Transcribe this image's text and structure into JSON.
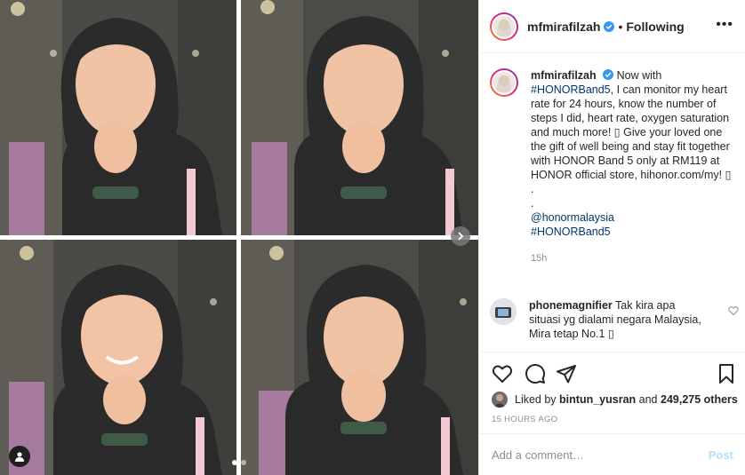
{
  "post": {
    "username": "mfmirafilzah",
    "follow_state": "Following",
    "separator": "•",
    "more_label": "•••",
    "caption": {
      "text_1": "Now with",
      "hashtag_1": "#HONORBand5",
      "text_2": ", I can monitor my heart rate for 24 hours, know the number of steps I did, heart rate, oxygen saturation and much more! ",
      "emoji_1": "▯",
      "text_3": " Give your loved one the gift of well being and stay fit together with HONOR Band 5 only at RM119 at HONOR official store, hihonor.com/my! ",
      "emoji_2": "▯",
      "text_4": " .",
      "dot_line": ".",
      "mention": "@honormalaysia",
      "hashtag_2": "#HONORBand5",
      "time": "15h"
    },
    "reply": {
      "username": "phonemagnifier",
      "text": " Tak kira apa situasi yg dialami negara Malaysia, Mira tetap No.1 ",
      "emoji": "▯"
    },
    "likes": {
      "prefix": "Liked by",
      "user": "bintun_yusran",
      "middle": "and",
      "count": "249,275 others"
    },
    "date": "15 HOURS AGO",
    "add_comment": {
      "placeholder": "Add a comment…",
      "post_label": "Post"
    },
    "carousel": {
      "slide_count": 2,
      "active_slide": 1
    }
  },
  "colors": {
    "link": "#00376b",
    "muted": "#8e8e8e",
    "verified": "#3897f0",
    "post_disabled": "#b2dffc"
  },
  "icons": [
    "verified-badge-icon",
    "heart-icon",
    "comment-icon",
    "share-icon",
    "bookmark-icon",
    "next-arrow-icon",
    "user-tag-icon",
    "heart-small-icon"
  ]
}
